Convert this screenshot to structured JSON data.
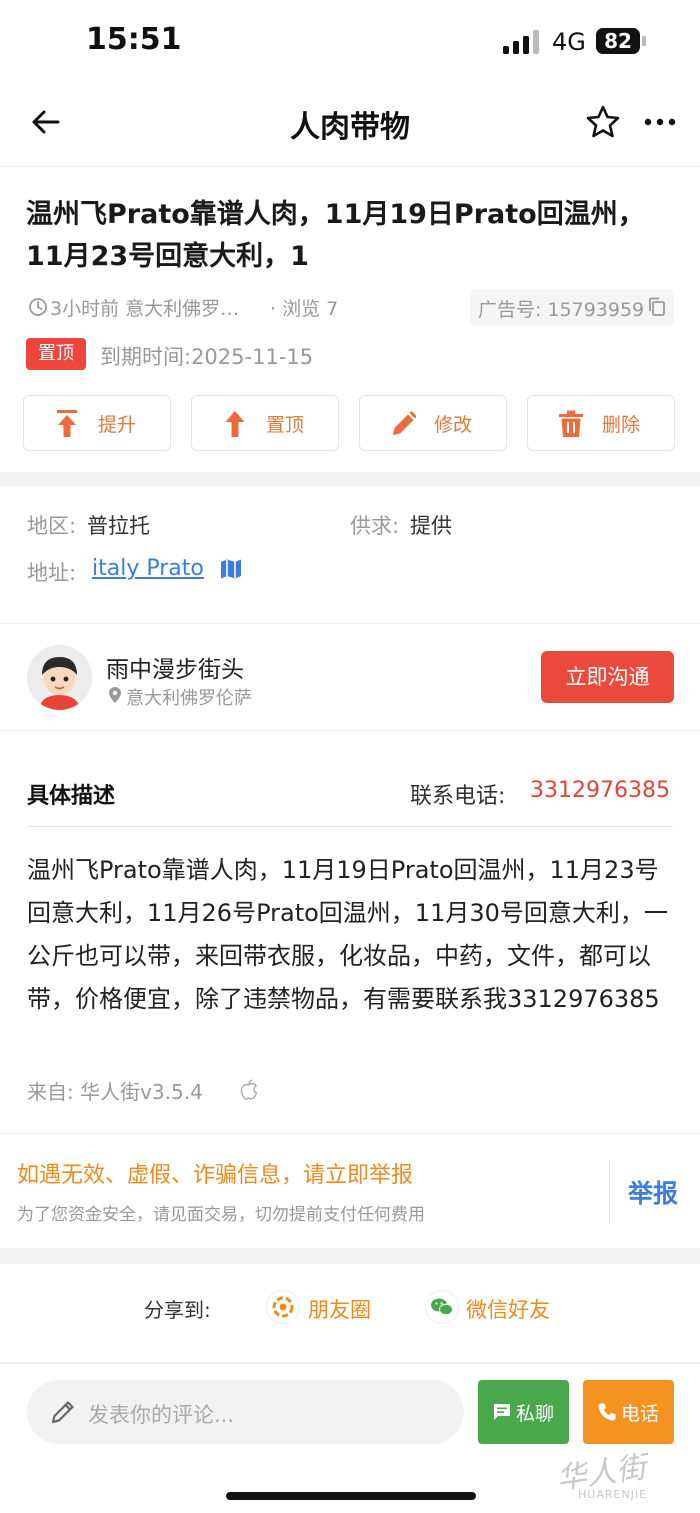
{
  "status_bar": {
    "time": "15:51",
    "network": "4G",
    "battery": "82"
  },
  "nav": {
    "title": "人肉带物"
  },
  "post": {
    "title": "温州飞Prato靠谱人肉，11月19日Prato回温州，11月23号回意大利，1",
    "time_location": "3小时前 意大利佛罗…",
    "views": "· 浏览 7",
    "ad_number": "广告号: 15793959",
    "pin_badge": "置顶",
    "expire": "到期时间:2025-11-15",
    "actions": [
      {
        "label": "提升",
        "icon": "boost-icon"
      },
      {
        "label": "置顶",
        "icon": "pin-top-icon"
      },
      {
        "label": "修改",
        "icon": "edit-icon"
      },
      {
        "label": "删除",
        "icon": "trash-icon"
      }
    ]
  },
  "info": {
    "region_label": "地区:",
    "region_value": "普拉托",
    "supply_label": "供求:",
    "supply_value": "提供",
    "address_label": "地址:",
    "address_value": "italy Prato"
  },
  "user": {
    "name": "雨中漫步街头",
    "location": "意大利佛罗伦萨",
    "contact_button": "立即沟通"
  },
  "description": {
    "heading": "具体描述",
    "phone_label": "联系电话:",
    "phone": "3312976385",
    "text": "温州飞Prato靠谱人肉，11月19日Prato回温州，11月23号回意大利，11月26号Prato回温州，11月30号回意大利，一公斤也可以带，来回带衣服，化妆品，中药，文件，都可以带，价格便宜，除了违禁物品，有需要联系我3312976385",
    "from": "来自: 华人街v3.5.4"
  },
  "report": {
    "title": "如遇无效、虚假、诈骗信息，请立即举报",
    "subtitle": "为了您资金安全，请见面交易，切勿提前支付任何费用",
    "button": "举报"
  },
  "share": {
    "label": "分享到:",
    "moments": "朋友圈",
    "wechat": "微信好友"
  },
  "bottom": {
    "comment_placeholder": "发表你的评论...",
    "pm_label": "私聊",
    "call_label": "电话"
  },
  "watermark": {
    "logo": "华人街",
    "sub": "HUARENJIE"
  },
  "colors": {
    "accent_red": "#ea4a3b",
    "orange": "#f08a1d",
    "green": "#48a84b",
    "link_blue": "#3b7dd8"
  }
}
